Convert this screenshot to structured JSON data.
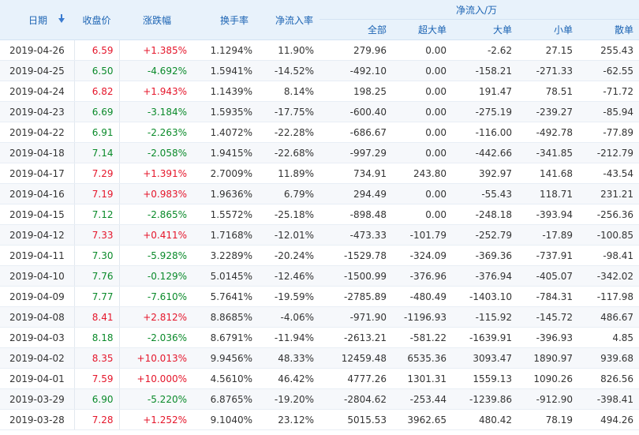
{
  "headers": {
    "date": "日期",
    "close": "收盘价",
    "change_pct": "涨跌幅",
    "turnover": "换手率",
    "net_inflow_rate": "净流入率",
    "net_inflow_group": "净流入/万",
    "total": "全部",
    "super_large": "超大单",
    "large": "大单",
    "small": "小单",
    "retail": "散单"
  },
  "rows": [
    {
      "date": "2019-04-26",
      "close": "6.59",
      "change": "+1.385%",
      "turnover": "1.1294%",
      "rate": "11.90%",
      "total": "279.96",
      "super": "0.00",
      "large": "-2.62",
      "small": "27.15",
      "retail": "255.43",
      "trend": "up"
    },
    {
      "date": "2019-04-25",
      "close": "6.50",
      "change": "-4.692%",
      "turnover": "1.5941%",
      "rate": "-14.52%",
      "total": "-492.10",
      "super": "0.00",
      "large": "-158.21",
      "small": "-271.33",
      "retail": "-62.55",
      "trend": "down"
    },
    {
      "date": "2019-04-24",
      "close": "6.82",
      "change": "+1.943%",
      "turnover": "1.1439%",
      "rate": "8.14%",
      "total": "198.25",
      "super": "0.00",
      "large": "191.47",
      "small": "78.51",
      "retail": "-71.72",
      "trend": "up"
    },
    {
      "date": "2019-04-23",
      "close": "6.69",
      "change": "-3.184%",
      "turnover": "1.5935%",
      "rate": "-17.75%",
      "total": "-600.40",
      "super": "0.00",
      "large": "-275.19",
      "small": "-239.27",
      "retail": "-85.94",
      "trend": "down"
    },
    {
      "date": "2019-04-22",
      "close": "6.91",
      "change": "-2.263%",
      "turnover": "1.4072%",
      "rate": "-22.28%",
      "total": "-686.67",
      "super": "0.00",
      "large": "-116.00",
      "small": "-492.78",
      "retail": "-77.89",
      "trend": "down"
    },
    {
      "date": "2019-04-18",
      "close": "7.14",
      "change": "-2.058%",
      "turnover": "1.9415%",
      "rate": "-22.68%",
      "total": "-997.29",
      "super": "0.00",
      "large": "-442.66",
      "small": "-341.85",
      "retail": "-212.79",
      "trend": "down"
    },
    {
      "date": "2019-04-17",
      "close": "7.29",
      "change": "+1.391%",
      "turnover": "2.7009%",
      "rate": "11.89%",
      "total": "734.91",
      "super": "243.80",
      "large": "392.97",
      "small": "141.68",
      "retail": "-43.54",
      "trend": "up"
    },
    {
      "date": "2019-04-16",
      "close": "7.19",
      "change": "+0.983%",
      "turnover": "1.9636%",
      "rate": "6.79%",
      "total": "294.49",
      "super": "0.00",
      "large": "-55.43",
      "small": "118.71",
      "retail": "231.21",
      "trend": "up"
    },
    {
      "date": "2019-04-15",
      "close": "7.12",
      "change": "-2.865%",
      "turnover": "1.5572%",
      "rate": "-25.18%",
      "total": "-898.48",
      "super": "0.00",
      "large": "-248.18",
      "small": "-393.94",
      "retail": "-256.36",
      "trend": "down"
    },
    {
      "date": "2019-04-12",
      "close": "7.33",
      "change": "+0.411%",
      "turnover": "1.7168%",
      "rate": "-12.01%",
      "total": "-473.33",
      "super": "-101.79",
      "large": "-252.79",
      "small": "-17.89",
      "retail": "-100.85",
      "trend": "up"
    },
    {
      "date": "2019-04-11",
      "close": "7.30",
      "change": "-5.928%",
      "turnover": "3.2289%",
      "rate": "-20.24%",
      "total": "-1529.78",
      "super": "-324.09",
      "large": "-369.36",
      "small": "-737.91",
      "retail": "-98.41",
      "trend": "down"
    },
    {
      "date": "2019-04-10",
      "close": "7.76",
      "change": "-0.129%",
      "turnover": "5.0145%",
      "rate": "-12.46%",
      "total": "-1500.99",
      "super": "-376.96",
      "large": "-376.94",
      "small": "-405.07",
      "retail": "-342.02",
      "trend": "down"
    },
    {
      "date": "2019-04-09",
      "close": "7.77",
      "change": "-7.610%",
      "turnover": "5.7641%",
      "rate": "-19.59%",
      "total": "-2785.89",
      "super": "-480.49",
      "large": "-1403.10",
      "small": "-784.31",
      "retail": "-117.98",
      "trend": "down"
    },
    {
      "date": "2019-04-08",
      "close": "8.41",
      "change": "+2.812%",
      "turnover": "8.8685%",
      "rate": "-4.06%",
      "total": "-971.90",
      "super": "-1196.93",
      "large": "-115.92",
      "small": "-145.72",
      "retail": "486.67",
      "trend": "up"
    },
    {
      "date": "2019-04-03",
      "close": "8.18",
      "change": "-2.036%",
      "turnover": "8.6791%",
      "rate": "-11.94%",
      "total": "-2613.21",
      "super": "-581.22",
      "large": "-1639.91",
      "small": "-396.93",
      "retail": "4.85",
      "trend": "down"
    },
    {
      "date": "2019-04-02",
      "close": "8.35",
      "change": "+10.013%",
      "turnover": "9.9456%",
      "rate": "48.33%",
      "total": "12459.48",
      "super": "6535.36",
      "large": "3093.47",
      "small": "1890.97",
      "retail": "939.68",
      "trend": "up"
    },
    {
      "date": "2019-04-01",
      "close": "7.59",
      "change": "+10.000%",
      "turnover": "4.5610%",
      "rate": "46.42%",
      "total": "4777.26",
      "super": "1301.31",
      "large": "1559.13",
      "small": "1090.26",
      "retail": "826.56",
      "trend": "up"
    },
    {
      "date": "2019-03-29",
      "close": "6.90",
      "change": "-5.220%",
      "turnover": "6.8765%",
      "rate": "-19.20%",
      "total": "-2804.62",
      "super": "-253.44",
      "large": "-1239.86",
      "small": "-912.90",
      "retail": "-398.41",
      "trend": "down"
    },
    {
      "date": "2019-03-28",
      "close": "7.28",
      "change": "+1.252%",
      "turnover": "9.1040%",
      "rate": "23.12%",
      "total": "5015.53",
      "super": "3962.65",
      "large": "480.42",
      "small": "78.19",
      "retail": "494.26",
      "trend": "up"
    }
  ],
  "colors": {
    "up": "#e5162b",
    "down": "#0a8a2a",
    "header_text": "#1b63b3",
    "header_bg": "#e8f2fb"
  }
}
